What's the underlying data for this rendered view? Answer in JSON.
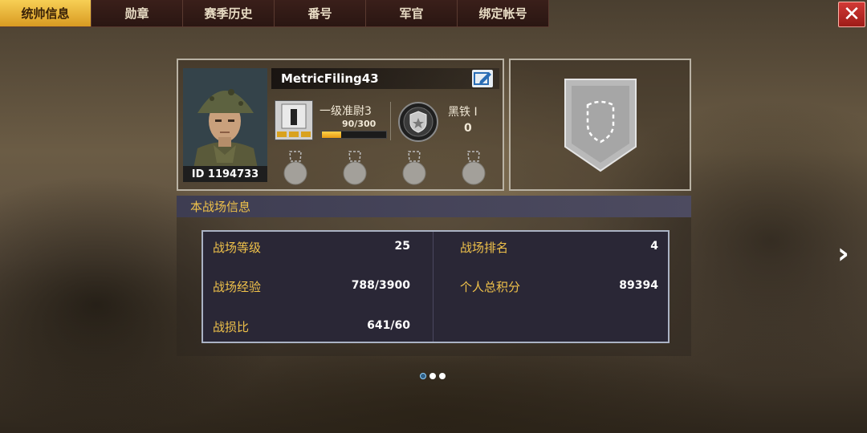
{
  "tabs": [
    {
      "label": "统帅信息",
      "active": true
    },
    {
      "label": "勋章",
      "active": false
    },
    {
      "label": "赛季历史",
      "active": false
    },
    {
      "label": "番号",
      "active": false
    },
    {
      "label": "军官",
      "active": false
    },
    {
      "label": "绑定帐号",
      "active": false
    }
  ],
  "close_icon": "close-icon",
  "player": {
    "name": "MetricFiling43",
    "id_text": "ID 1194733",
    "rank_name": "一级准尉3",
    "rank_exp": "90/300",
    "rank_exp_fraction": 0.3,
    "tier_name": "黑铁 I",
    "tier_value": "0",
    "medal_slots": 4
  },
  "battlefield": {
    "section_title": "本战场信息",
    "stats": [
      {
        "label": "战场等级",
        "value": "25"
      },
      {
        "label": "战场排名",
        "value": "4"
      },
      {
        "label": "战场经验",
        "value": "788/3900"
      },
      {
        "label": "个人总积分",
        "value": "89394"
      },
      {
        "label": "战损比",
        "value": "641/60"
      }
    ]
  },
  "pager": {
    "pages": 3,
    "current": 0
  },
  "colors": {
    "accent_gold": "#f0c24a",
    "tab_active": "#f7cf55",
    "close_red": "#d23a36",
    "stats_bg": "#2a2736"
  }
}
